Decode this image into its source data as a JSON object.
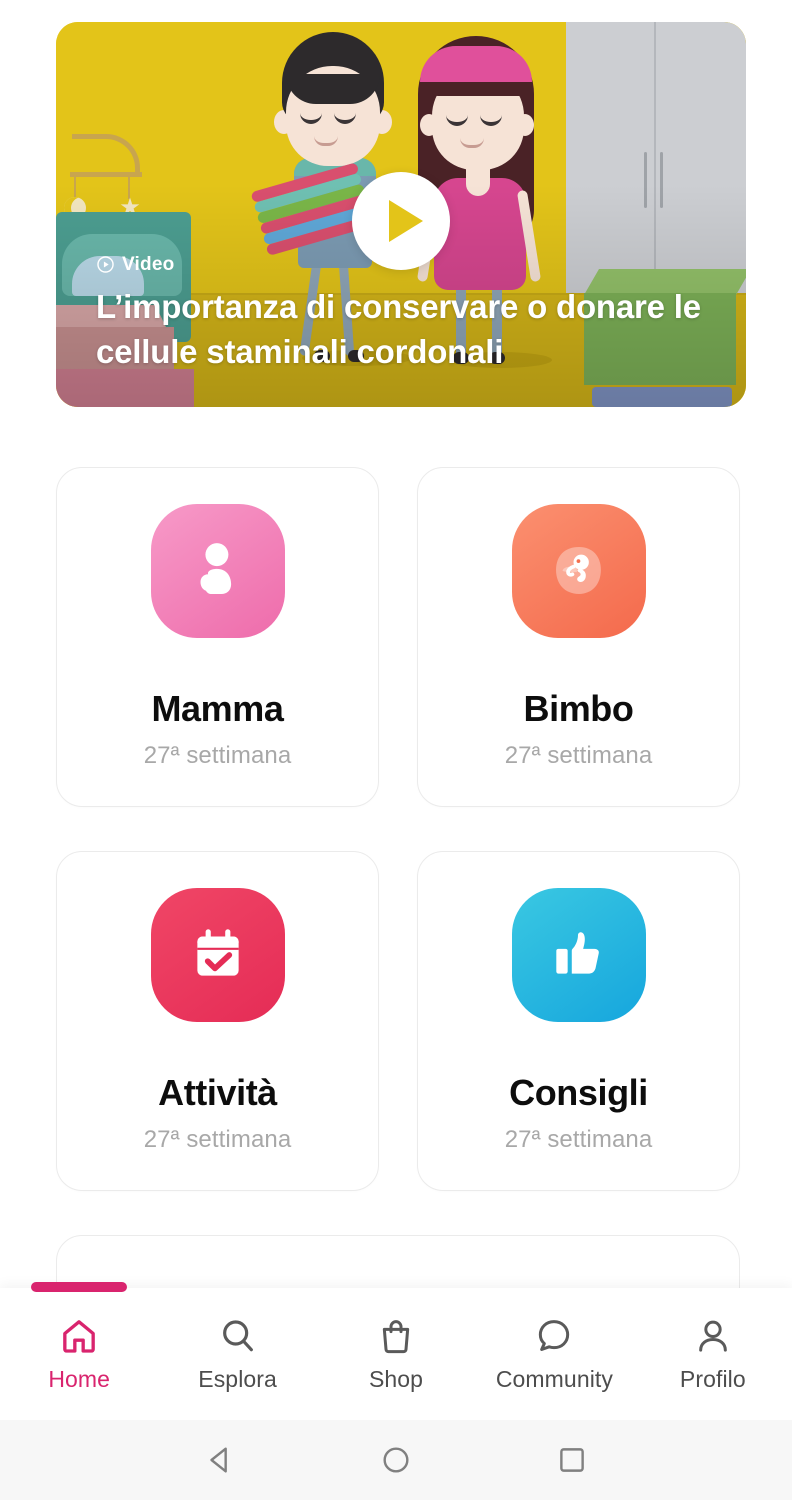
{
  "hero": {
    "badge_label": "Video",
    "badge_icon": "play-circle-icon",
    "title": "L’importanza di conservare o donare le cellule staminali cordonali",
    "play_icon": "play-icon",
    "background_color": "#e3c419"
  },
  "tiles": [
    {
      "title": "Mamma",
      "subtitle": "27ª settimana",
      "icon": "pregnant-woman-icon",
      "color_from": "#f58fc0",
      "color_to": "#ef6fae"
    },
    {
      "title": "Bimbo",
      "subtitle": "27ª settimana",
      "icon": "fetus-icon",
      "color_from": "#fa8a63",
      "color_to": "#f4704f"
    },
    {
      "title": "Attività",
      "subtitle": "27ª settimana",
      "icon": "calendar-check-icon",
      "color_from": "#ef3b62",
      "color_to": "#e62d57"
    },
    {
      "title": "Consigli",
      "subtitle": "27ª settimana",
      "icon": "thumbs-up-icon",
      "color_from": "#35c3e0",
      "color_to": "#18a8dd"
    }
  ],
  "bottom_nav": {
    "active_color": "#d9246e",
    "inactive_color": "#4d4d4d",
    "items": [
      {
        "label": "Home",
        "icon": "home-icon",
        "active": true
      },
      {
        "label": "Esplora",
        "icon": "search-icon",
        "active": false
      },
      {
        "label": "Shop",
        "icon": "shopping-bag-icon",
        "active": false
      },
      {
        "label": "Community",
        "icon": "chat-bubble-icon",
        "active": false
      },
      {
        "label": "Profilo",
        "icon": "person-icon",
        "active": false
      }
    ]
  },
  "system_bar": {
    "back_icon": "back-triangle-icon",
    "home_icon": "home-circle-icon",
    "recents_icon": "recents-square-icon"
  }
}
